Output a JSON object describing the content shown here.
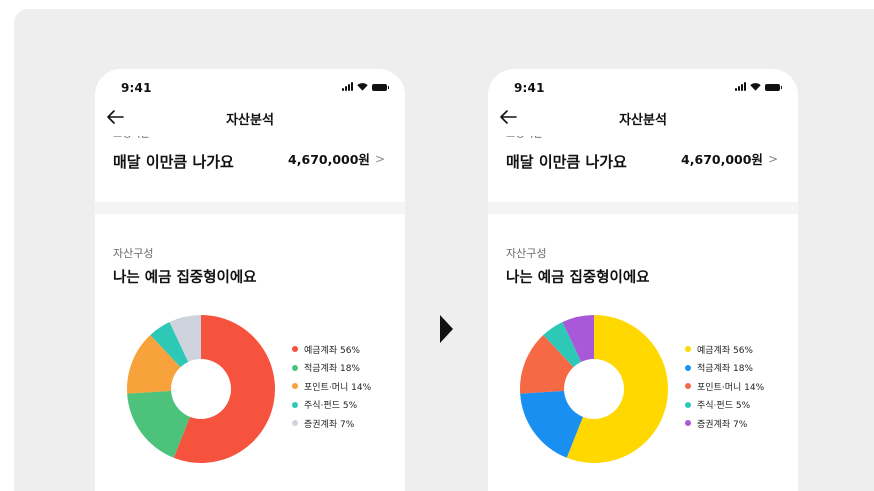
{
  "time": "9:41",
  "nav": {
    "title": "자산분석"
  },
  "spend": {
    "label": "고정지출",
    "title": "매달 이만큼 나가요",
    "amount": "4,670,000원"
  },
  "asset": {
    "label": "자산구성",
    "title": "나는 예금 집중형이에요"
  },
  "chart_data": [
    {
      "type": "pie",
      "labels": [
        "예금계좌 56%",
        "적금계좌 18%",
        "포인트·머니 14%",
        "주식·펀드 5%",
        "증권계좌 7%"
      ],
      "values": [
        56,
        18,
        14,
        5,
        7
      ],
      "colors": [
        "#f5533d",
        "#4cc27a",
        "#f7a23a",
        "#2ec8b7",
        "#cfd3de"
      ]
    },
    {
      "type": "pie",
      "labels": [
        "예금계좌 56%",
        "적금계좌 18%",
        "포인트·머니 14%",
        "주식·펀드 5%",
        "증권계좌 7%"
      ],
      "values": [
        56,
        18,
        14,
        5,
        7
      ],
      "colors": [
        "#ffd800",
        "#1a8ff2",
        "#f56a45",
        "#2ec8b7",
        "#a958d9"
      ]
    }
  ]
}
